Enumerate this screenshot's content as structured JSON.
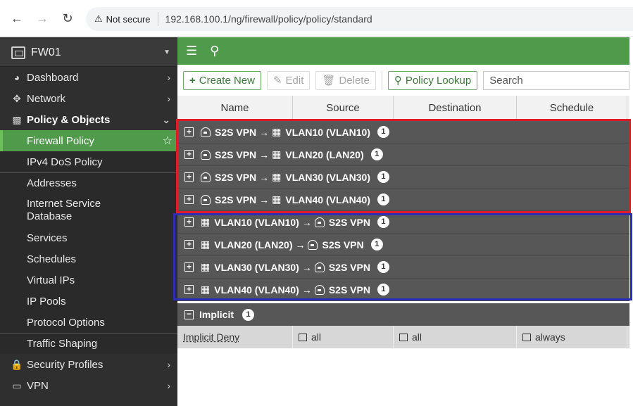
{
  "browser": {
    "warning": "Not secure",
    "url": "192.168.100.1/ng/firewall/policy/policy/standard"
  },
  "sidebar": {
    "device": "FW01",
    "items": [
      {
        "label": "Dashboard",
        "icon": "dashboard-icon"
      },
      {
        "label": "Network",
        "icon": "network-icon"
      },
      {
        "label": "Policy & Objects",
        "icon": "policy-icon"
      },
      {
        "label": "Firewall Policy"
      },
      {
        "label": "IPv4 DoS Policy"
      },
      {
        "label": "Addresses"
      },
      {
        "label": "Internet Service Database"
      },
      {
        "label": "Services"
      },
      {
        "label": "Schedules"
      },
      {
        "label": "Virtual IPs"
      },
      {
        "label": "IP Pools"
      },
      {
        "label": "Protocol Options"
      },
      {
        "label": "Traffic Shaping"
      },
      {
        "label": "Security Profiles",
        "icon": "lock-icon"
      },
      {
        "label": "VPN",
        "icon": "monitor-icon"
      }
    ]
  },
  "toolbar": {
    "create": "Create New",
    "edit": "Edit",
    "delete": "Delete",
    "lookup": "Policy Lookup",
    "search_placeholder": "Search"
  },
  "table": {
    "columns": [
      "Name",
      "Source",
      "Destination",
      "Schedule"
    ],
    "groups": [
      {
        "from": "S2S VPN",
        "to": "VLAN10 (VLAN10)",
        "count": "1",
        "dir": "in"
      },
      {
        "from": "S2S VPN",
        "to": "VLAN20 (LAN20)",
        "count": "1",
        "dir": "in"
      },
      {
        "from": "S2S VPN",
        "to": "VLAN30 (VLAN30)",
        "count": "1",
        "dir": "in"
      },
      {
        "from": "S2S VPN",
        "to": "VLAN40 (VLAN40)",
        "count": "1",
        "dir": "in"
      },
      {
        "from": "VLAN10 (VLAN10)",
        "to": "S2S VPN",
        "count": "1",
        "dir": "out"
      },
      {
        "from": "VLAN20 (LAN20)",
        "to": "S2S VPN",
        "count": "1",
        "dir": "out"
      },
      {
        "from": "VLAN30 (VLAN30)",
        "to": "S2S VPN",
        "count": "1",
        "dir": "out"
      },
      {
        "from": "VLAN40 (VLAN40)",
        "to": "S2S VPN",
        "count": "1",
        "dir": "out"
      }
    ],
    "implicit": {
      "label": "Implicit",
      "count": "1"
    },
    "implicit_row": {
      "name": "Implicit Deny",
      "source": "all",
      "destination": "all",
      "schedule": "always"
    }
  },
  "colors": {
    "brand_green": "#4f9a4b",
    "highlight_red": "#e11b2a",
    "highlight_blue": "#2c2fb5"
  }
}
